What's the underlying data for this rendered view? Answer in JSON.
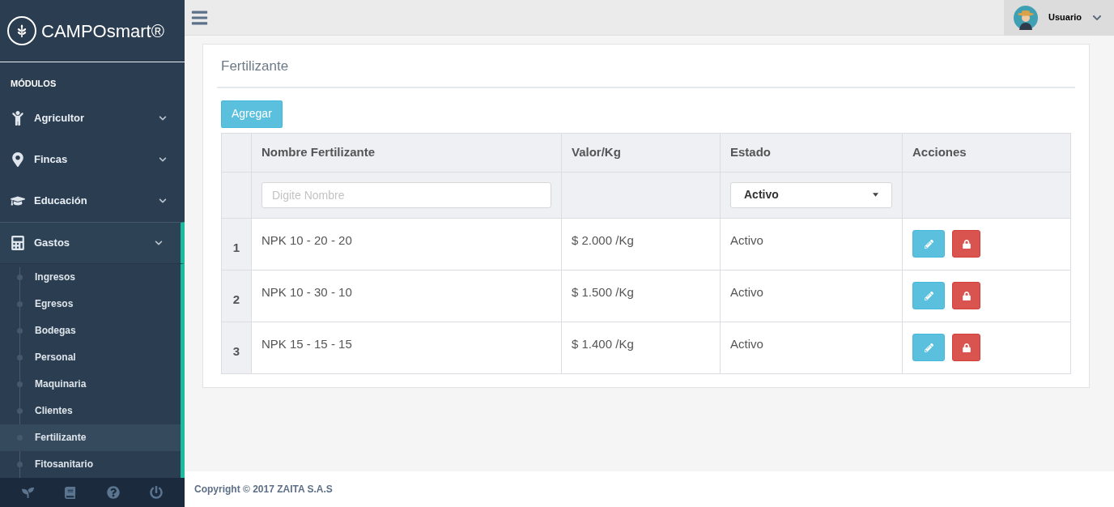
{
  "brand": {
    "name": "CAMPOsmart®"
  },
  "sidebar": {
    "section_title": "MÓDULOS",
    "items": [
      {
        "label": "Agricultor",
        "expanded": false
      },
      {
        "label": "Fincas",
        "expanded": false
      },
      {
        "label": "Educación",
        "expanded": false
      },
      {
        "label": "Gastos",
        "expanded": true,
        "children": [
          {
            "label": "Ingresos",
            "selected": false
          },
          {
            "label": "Egresos",
            "selected": false
          },
          {
            "label": "Bodegas",
            "selected": false
          },
          {
            "label": "Personal",
            "selected": false
          },
          {
            "label": "Maquinaria",
            "selected": false
          },
          {
            "label": "Clientes",
            "selected": false
          },
          {
            "label": "Fertilizante",
            "selected": true
          },
          {
            "label": "Fitosanitario",
            "selected": false
          }
        ]
      }
    ]
  },
  "topbar": {
    "user": "Usuario"
  },
  "panel": {
    "title": "Fertilizante",
    "add_button": "Agregar",
    "table": {
      "columns": [
        "Nombre Fertilizante",
        "Valor/Kg",
        "Estado",
        "Acciones"
      ],
      "filter": {
        "placeholder": "Digite Nombre",
        "estado": "Activo"
      },
      "rows": [
        {
          "index": "1",
          "name": "NPK 10 - 20 - 20",
          "value": "$ 2.000 /Kg",
          "status": "Activo"
        },
        {
          "index": "2",
          "name": "NPK 10 - 30 - 10",
          "value": "$ 1.500 /Kg",
          "status": "Activo"
        },
        {
          "index": "3",
          "name": "NPK 15 - 15 - 15",
          "value": "$ 1.400 /Kg",
          "status": "Activo"
        }
      ]
    }
  },
  "footer": {
    "text": "Copyright © 2017 ZAITA S.A.S"
  }
}
